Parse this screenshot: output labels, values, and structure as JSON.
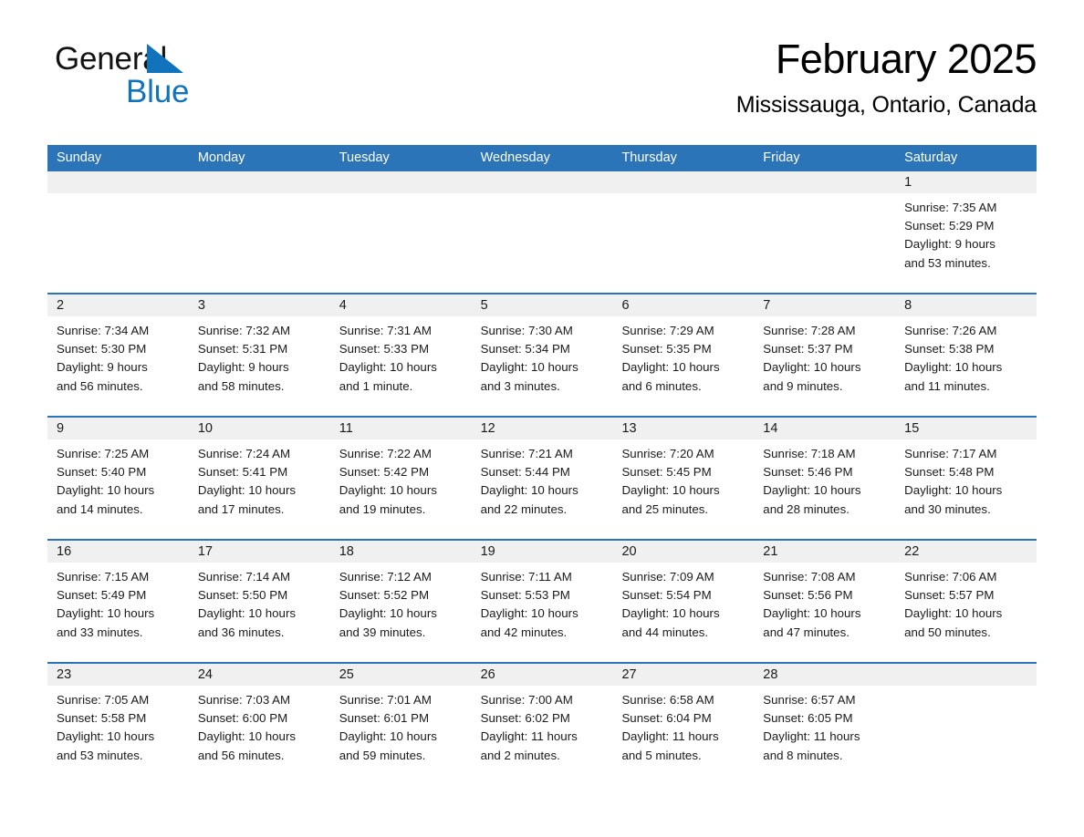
{
  "brand": {
    "name_part1": "General",
    "name_part2": "Blue",
    "logo_icon": "triangle-icon",
    "accent_color": "#1273bd"
  },
  "header": {
    "title": "February 2025",
    "subtitle": "Mississauga, Ontario, Canada"
  },
  "theme": {
    "header_bg": "#2b74b8",
    "daynum_bg": "#f0f0f0",
    "cell_bg": "#ffffff",
    "text": "#1a1a1a"
  },
  "calendar": {
    "weekdays": [
      "Sunday",
      "Monday",
      "Tuesday",
      "Wednesday",
      "Thursday",
      "Friday",
      "Saturday"
    ],
    "weeks": [
      [
        {
          "day": "",
          "lines": []
        },
        {
          "day": "",
          "lines": []
        },
        {
          "day": "",
          "lines": []
        },
        {
          "day": "",
          "lines": []
        },
        {
          "day": "",
          "lines": []
        },
        {
          "day": "",
          "lines": []
        },
        {
          "day": "1",
          "lines": [
            "Sunrise: 7:35 AM",
            "Sunset: 5:29 PM",
            "Daylight: 9 hours",
            "and 53 minutes."
          ]
        }
      ],
      [
        {
          "day": "2",
          "lines": [
            "Sunrise: 7:34 AM",
            "Sunset: 5:30 PM",
            "Daylight: 9 hours",
            "and 56 minutes."
          ]
        },
        {
          "day": "3",
          "lines": [
            "Sunrise: 7:32 AM",
            "Sunset: 5:31 PM",
            "Daylight: 9 hours",
            "and 58 minutes."
          ]
        },
        {
          "day": "4",
          "lines": [
            "Sunrise: 7:31 AM",
            "Sunset: 5:33 PM",
            "Daylight: 10 hours",
            "and 1 minute."
          ]
        },
        {
          "day": "5",
          "lines": [
            "Sunrise: 7:30 AM",
            "Sunset: 5:34 PM",
            "Daylight: 10 hours",
            "and 3 minutes."
          ]
        },
        {
          "day": "6",
          "lines": [
            "Sunrise: 7:29 AM",
            "Sunset: 5:35 PM",
            "Daylight: 10 hours",
            "and 6 minutes."
          ]
        },
        {
          "day": "7",
          "lines": [
            "Sunrise: 7:28 AM",
            "Sunset: 5:37 PM",
            "Daylight: 10 hours",
            "and 9 minutes."
          ]
        },
        {
          "day": "8",
          "lines": [
            "Sunrise: 7:26 AM",
            "Sunset: 5:38 PM",
            "Daylight: 10 hours",
            "and 11 minutes."
          ]
        }
      ],
      [
        {
          "day": "9",
          "lines": [
            "Sunrise: 7:25 AM",
            "Sunset: 5:40 PM",
            "Daylight: 10 hours",
            "and 14 minutes."
          ]
        },
        {
          "day": "10",
          "lines": [
            "Sunrise: 7:24 AM",
            "Sunset: 5:41 PM",
            "Daylight: 10 hours",
            "and 17 minutes."
          ]
        },
        {
          "day": "11",
          "lines": [
            "Sunrise: 7:22 AM",
            "Sunset: 5:42 PM",
            "Daylight: 10 hours",
            "and 19 minutes."
          ]
        },
        {
          "day": "12",
          "lines": [
            "Sunrise: 7:21 AM",
            "Sunset: 5:44 PM",
            "Daylight: 10 hours",
            "and 22 minutes."
          ]
        },
        {
          "day": "13",
          "lines": [
            "Sunrise: 7:20 AM",
            "Sunset: 5:45 PM",
            "Daylight: 10 hours",
            "and 25 minutes."
          ]
        },
        {
          "day": "14",
          "lines": [
            "Sunrise: 7:18 AM",
            "Sunset: 5:46 PM",
            "Daylight: 10 hours",
            "and 28 minutes."
          ]
        },
        {
          "day": "15",
          "lines": [
            "Sunrise: 7:17 AM",
            "Sunset: 5:48 PM",
            "Daylight: 10 hours",
            "and 30 minutes."
          ]
        }
      ],
      [
        {
          "day": "16",
          "lines": [
            "Sunrise: 7:15 AM",
            "Sunset: 5:49 PM",
            "Daylight: 10 hours",
            "and 33 minutes."
          ]
        },
        {
          "day": "17",
          "lines": [
            "Sunrise: 7:14 AM",
            "Sunset: 5:50 PM",
            "Daylight: 10 hours",
            "and 36 minutes."
          ]
        },
        {
          "day": "18",
          "lines": [
            "Sunrise: 7:12 AM",
            "Sunset: 5:52 PM",
            "Daylight: 10 hours",
            "and 39 minutes."
          ]
        },
        {
          "day": "19",
          "lines": [
            "Sunrise: 7:11 AM",
            "Sunset: 5:53 PM",
            "Daylight: 10 hours",
            "and 42 minutes."
          ]
        },
        {
          "day": "20",
          "lines": [
            "Sunrise: 7:09 AM",
            "Sunset: 5:54 PM",
            "Daylight: 10 hours",
            "and 44 minutes."
          ]
        },
        {
          "day": "21",
          "lines": [
            "Sunrise: 7:08 AM",
            "Sunset: 5:56 PM",
            "Daylight: 10 hours",
            "and 47 minutes."
          ]
        },
        {
          "day": "22",
          "lines": [
            "Sunrise: 7:06 AM",
            "Sunset: 5:57 PM",
            "Daylight: 10 hours",
            "and 50 minutes."
          ]
        }
      ],
      [
        {
          "day": "23",
          "lines": [
            "Sunrise: 7:05 AM",
            "Sunset: 5:58 PM",
            "Daylight: 10 hours",
            "and 53 minutes."
          ]
        },
        {
          "day": "24",
          "lines": [
            "Sunrise: 7:03 AM",
            "Sunset: 6:00 PM",
            "Daylight: 10 hours",
            "and 56 minutes."
          ]
        },
        {
          "day": "25",
          "lines": [
            "Sunrise: 7:01 AM",
            "Sunset: 6:01 PM",
            "Daylight: 10 hours",
            "and 59 minutes."
          ]
        },
        {
          "day": "26",
          "lines": [
            "Sunrise: 7:00 AM",
            "Sunset: 6:02 PM",
            "Daylight: 11 hours",
            "and 2 minutes."
          ]
        },
        {
          "day": "27",
          "lines": [
            "Sunrise: 6:58 AM",
            "Sunset: 6:04 PM",
            "Daylight: 11 hours",
            "and 5 minutes."
          ]
        },
        {
          "day": "28",
          "lines": [
            "Sunrise: 6:57 AM",
            "Sunset: 6:05 PM",
            "Daylight: 11 hours",
            "and 8 minutes."
          ]
        },
        {
          "day": "",
          "lines": []
        }
      ]
    ]
  }
}
